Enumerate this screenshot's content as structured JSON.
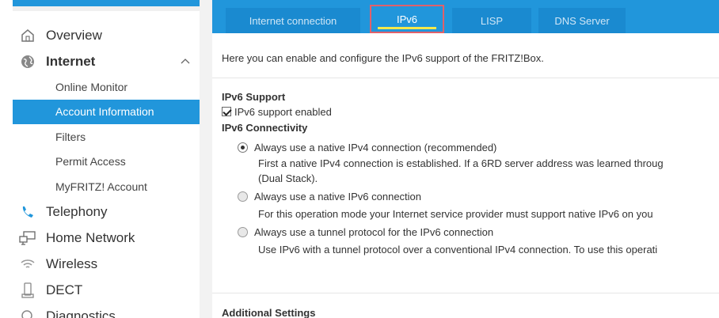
{
  "sidebar": {
    "items": [
      {
        "label": "Overview",
        "icon": "home-icon"
      },
      {
        "label": "Internet",
        "icon": "globe-icon",
        "expanded": true
      },
      {
        "label": "Telephony",
        "icon": "phone-icon"
      },
      {
        "label": "Home Network",
        "icon": "monitor-network-icon"
      },
      {
        "label": "Wireless",
        "icon": "wifi-icon"
      },
      {
        "label": "DECT",
        "icon": "cordless-phone-icon"
      },
      {
        "label": "Diagnostics",
        "icon": "diagnostics-icon"
      }
    ],
    "internet_subitems": [
      {
        "label": "Online Monitor"
      },
      {
        "label": "Account Information",
        "active": true
      },
      {
        "label": "Filters"
      },
      {
        "label": "Permit Access"
      },
      {
        "label": "MyFRITZ! Account"
      }
    ]
  },
  "tabs": [
    {
      "label": "Internet connection"
    },
    {
      "label": "IPv6",
      "active": true
    },
    {
      "label": "LISP"
    },
    {
      "label": "DNS Server"
    }
  ],
  "main": {
    "intro": "Here you can enable and configure the IPv6 support of the FRITZ!Box.",
    "ipv6_support_title": "IPv6 Support",
    "ipv6_support_checkbox": "IPv6 support enabled",
    "connectivity_title": "IPv6 Connectivity",
    "options": [
      {
        "label": "Always use a native IPv4 connection (recommended)",
        "selected": true,
        "desc1": "First a native IPv4 connection is established. If a 6RD server address was learned throug",
        "desc2": "(Dual Stack)."
      },
      {
        "label": "Always use a native IPv6 connection",
        "selected": false,
        "desc1": "For this operation mode your Internet service provider must support native IPv6 on you"
      },
      {
        "label": "Always use a tunnel protocol for the IPv6 connection",
        "selected": false,
        "desc1": "Use IPv6 with a tunnel protocol over a conventional IPv4 connection. To use this operati"
      }
    ],
    "additional_title": "Additional Settings"
  },
  "colors": {
    "accent": "#2196db",
    "active_tab_border": "#e0616b",
    "tab_underline": "#f6e94b"
  }
}
